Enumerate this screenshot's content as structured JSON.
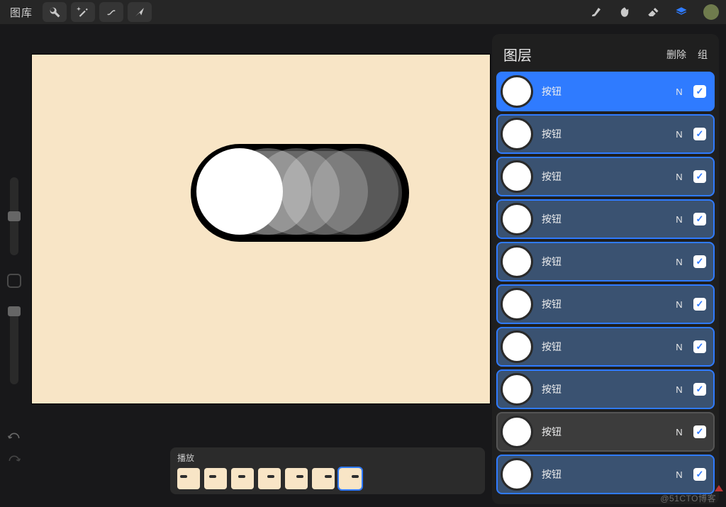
{
  "topbar": {
    "library_label": "图库",
    "icons_left": [
      "wrench-icon",
      "magic-icon",
      "shape-icon",
      "pointer-icon"
    ],
    "icons_right": [
      "brush-icon",
      "smudge-icon",
      "eraser-icon",
      "layers-icon",
      "avatar-icon"
    ]
  },
  "timeline": {
    "play_label": "播放",
    "frame_count": 7,
    "active_frame_index": 6
  },
  "layers_panel": {
    "title": "图层",
    "delete_label": "删除",
    "group_label": "组",
    "blend_code": "N",
    "rows": [
      {
        "label": "按钮",
        "state": "selected"
      },
      {
        "label": "按钮",
        "state": "normal"
      },
      {
        "label": "按钮",
        "state": "normal"
      },
      {
        "label": "按钮",
        "state": "normal"
      },
      {
        "label": "按钮",
        "state": "normal"
      },
      {
        "label": "按钮",
        "state": "normal"
      },
      {
        "label": "按钮",
        "state": "normal"
      },
      {
        "label": "按钮",
        "state": "normal"
      },
      {
        "label": "按钮",
        "state": "sub"
      },
      {
        "label": "按钮",
        "state": "normal"
      }
    ]
  },
  "colors": {
    "accent": "#2f7bff",
    "canvas_bg": "#f8e5c6",
    "panel_bg": "#1f1f1f"
  },
  "watermark": "@51CTO博客"
}
